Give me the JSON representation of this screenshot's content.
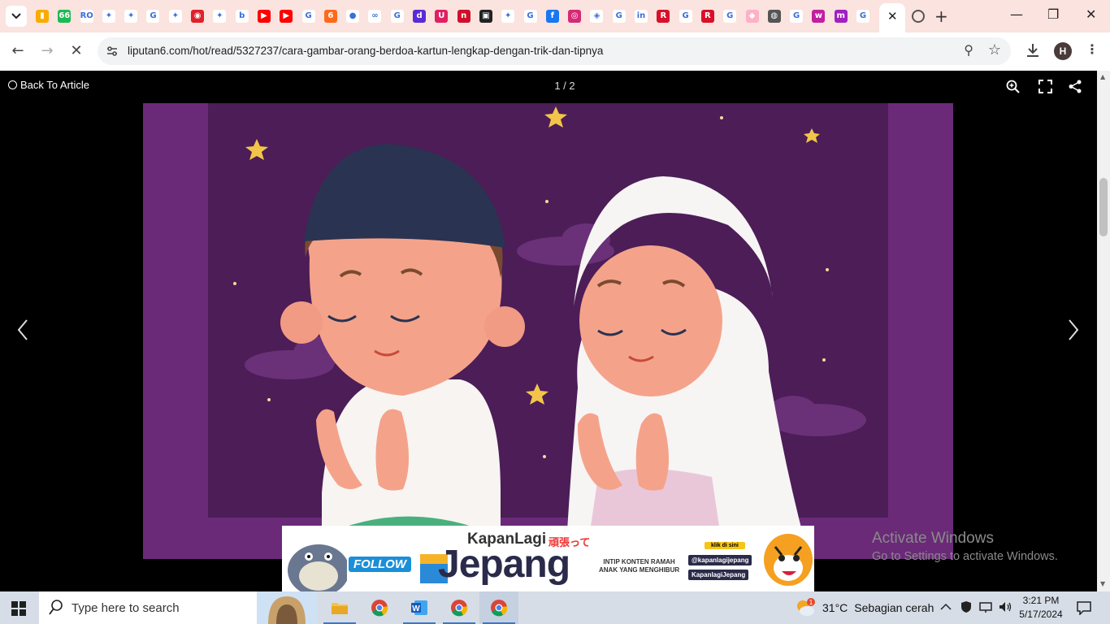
{
  "browser": {
    "url": "liputan6.com/hot/read/5327237/cara-gambar-orang-berdoa-kartun-lengkap-dengan-trik-dan-tipnya",
    "profile_initial": "H",
    "favicons": [
      {
        "name": "analytics-favicon",
        "bg": "#f9ab00",
        "glyph": "▮"
      },
      {
        "name": "sixtysix-favicon",
        "bg": "#1db954",
        "glyph": "66"
      },
      {
        "name": "ro-favicon",
        "bg": "#ffffff",
        "glyph": "RO"
      },
      {
        "name": "garuda-favicon",
        "bg": "#ffffff",
        "glyph": "✦"
      },
      {
        "name": "garuda-favicon",
        "bg": "#ffffff",
        "glyph": "✦"
      },
      {
        "name": "google-favicon",
        "bg": "#ffffff",
        "glyph": "G"
      },
      {
        "name": "garuda-favicon",
        "bg": "#ffffff",
        "glyph": "✦"
      },
      {
        "name": "target-favicon",
        "bg": "#e0202a",
        "glyph": "◉"
      },
      {
        "name": "garuda-favicon",
        "bg": "#ffffff",
        "glyph": "✦"
      },
      {
        "name": "bing-favicon",
        "bg": "#ffffff",
        "glyph": "b"
      },
      {
        "name": "youtube-favicon",
        "bg": "#ff0000",
        "glyph": "▶"
      },
      {
        "name": "youtube-favicon",
        "bg": "#ff0000",
        "glyph": "▶"
      },
      {
        "name": "google-favicon",
        "bg": "#ffffff",
        "glyph": "G"
      },
      {
        "name": "six-favicon",
        "bg": "#ff6a1a",
        "glyph": "6"
      },
      {
        "name": "github-favicon",
        "bg": "#ffffff",
        "glyph": "●"
      },
      {
        "name": "link-favicon",
        "bg": "#ffffff",
        "glyph": "∞"
      },
      {
        "name": "google-favicon",
        "bg": "#ffffff",
        "glyph": "G"
      },
      {
        "name": "d-favicon",
        "bg": "#5b2bd6",
        "glyph": "d"
      },
      {
        "name": "u-favicon",
        "bg": "#e02060",
        "glyph": "U"
      },
      {
        "name": "n-favicon",
        "bg": "#d0102a",
        "glyph": "n"
      },
      {
        "name": "box-favicon",
        "bg": "#222222",
        "glyph": "▣"
      },
      {
        "name": "garuda-favicon",
        "bg": "#ffffff",
        "glyph": "✦"
      },
      {
        "name": "google-favicon",
        "bg": "#ffffff",
        "glyph": "G"
      },
      {
        "name": "facebook-favicon",
        "bg": "#1877f2",
        "glyph": "f"
      },
      {
        "name": "instagram-favicon",
        "bg": "#d62976",
        "glyph": "◎"
      },
      {
        "name": "maps-favicon",
        "bg": "#ffffff",
        "glyph": "◈"
      },
      {
        "name": "google-favicon",
        "bg": "#ffffff",
        "glyph": "G"
      },
      {
        "name": "linkedin-favicon",
        "bg": "#ffffff",
        "glyph": "in"
      },
      {
        "name": "r-favicon",
        "bg": "#d8102a",
        "glyph": "R"
      },
      {
        "name": "google-favicon",
        "bg": "#ffffff",
        "glyph": "G"
      },
      {
        "name": "r-favicon",
        "bg": "#d8102a",
        "glyph": "R"
      },
      {
        "name": "google-favicon",
        "bg": "#ffffff",
        "glyph": "G"
      },
      {
        "name": "pink-favicon",
        "bg": "#ffb0c8",
        "glyph": "◆"
      },
      {
        "name": "globe-favicon",
        "bg": "#555555",
        "glyph": "◍"
      },
      {
        "name": "google-favicon",
        "bg": "#ffffff",
        "glyph": "G"
      },
      {
        "name": "w-favicon",
        "bg": "#c020a0",
        "glyph": "w"
      },
      {
        "name": "m-favicon",
        "bg": "#a020c0",
        "glyph": "m"
      },
      {
        "name": "google-favicon",
        "bg": "#ffffff",
        "glyph": "G"
      }
    ]
  },
  "viewer": {
    "back_label": "Back To Article",
    "counter": "1 / 2"
  },
  "ad": {
    "follow": "FOLLOW",
    "brand_small": "KapanLagi",
    "brand_jp": "頑張って",
    "brand_main": "Jepang",
    "tagline_1": "INTIP KONTEN RAMAH",
    "tagline_2": "ANAK YANG MENGHIBUR",
    "klik": "klik di sini",
    "handle_ig": "@kapanlagijepang",
    "handle_tt": "KapanlagiJepang"
  },
  "watermark": {
    "title": "Activate Windows",
    "subtitle": "Go to Settings to activate Windows."
  },
  "taskbar": {
    "search_placeholder": "Type here to search",
    "weather_temp": "31°C",
    "weather_text": "Sebagian cerah",
    "weather_badge": "1",
    "time": "3:21 PM",
    "date": "5/17/2024"
  }
}
